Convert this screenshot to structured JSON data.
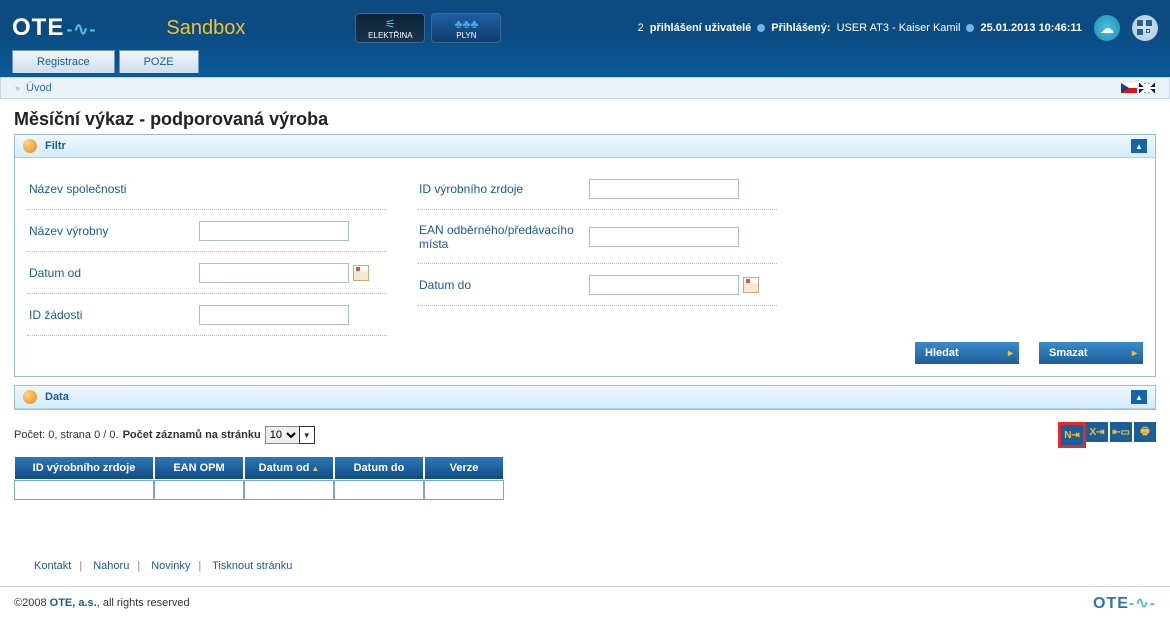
{
  "header": {
    "logo": "OTE",
    "sandbox": "Sandbox",
    "elec_label": "ELEKTŘINA",
    "gas_label": "PLYN",
    "login_count": "2",
    "login_users_label": "přihlášení uživatelé",
    "logged_in_label": "Přihlášený:",
    "user_name": "USER AT3 - Kaiser Kamil",
    "datetime": "25.01.2013 10:46:11"
  },
  "nav": {
    "tab1": "Registrace",
    "tab2": "POZE"
  },
  "breadcrumb": {
    "home": "Úvod"
  },
  "page": {
    "title": "Měsíční výkaz - podporovaná výroba"
  },
  "filter": {
    "panel_title": "Filtr",
    "fields": {
      "company_name": "Název společnosti",
      "plant_name": "Název výrobny",
      "date_from": "Datum od",
      "request_id": "ID žádosti",
      "source_id": "ID výrobního zrdoje",
      "ean": "EAN odběrného/předávacího místa",
      "date_to": "Datum do"
    },
    "btn_search": "Hledat",
    "btn_clear": "Smazat"
  },
  "data": {
    "panel_title": "Data",
    "count_prefix": "Počet: 0, strana 0 / 0.",
    "page_size_label": "Počet záznamů na stránku",
    "page_size_value": "10",
    "columns": {
      "source_id": "ID výrobního zrdoje",
      "ean_opm": "EAN OPM",
      "date_from": "Datum od",
      "date_to": "Datum do",
      "version": "Verze"
    }
  },
  "footer": {
    "links": {
      "kontakt": "Kontakt",
      "nahoru": "Nahoru",
      "novinky": "Novinky",
      "tisk": "Tisknout stránku"
    },
    "copyright_year": "©2008",
    "copyright_company": "OTE, a.s.",
    "copyright_rest": ", all rights reserved",
    "footer_logo": "OTE"
  }
}
